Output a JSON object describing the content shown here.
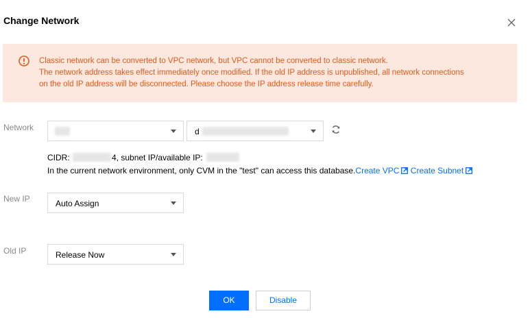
{
  "dialog": {
    "title": "Change Network"
  },
  "alert": {
    "lines": [
      "Classic network can be converted to VPC network, but VPC cannot be converted to classic network.",
      "The network address takes effect immediately once modified. If the old IP address is unpublished, all network connections",
      "on the old IP address will be disconnected. Please choose the IP address release time carefully."
    ],
    "color": "#e05a1a",
    "background": "#fde8df"
  },
  "network": {
    "label": "Network",
    "vpc_value": "",
    "subnet_value_prefix": "d",
    "cidr_label": "CIDR:",
    "cidr_suffix": "4, subnet IP/available IP:",
    "environment_text": "In the current network environment, only CVM in the \"test\" can access this database.",
    "create_vpc": "Create VPC",
    "create_subnet": "Create Subnet"
  },
  "new_ip": {
    "label": "New IP",
    "value": "Auto Assign"
  },
  "old_ip": {
    "label": "Old IP",
    "value": "Release Now"
  },
  "buttons": {
    "ok": "OK",
    "disable": "Disable"
  },
  "colors": {
    "primary": "#006eff",
    "label": "#888888"
  },
  "icons": [
    "close-icon",
    "warning-icon",
    "chevron-down-icon",
    "refresh-icon",
    "external-link-icon"
  ]
}
